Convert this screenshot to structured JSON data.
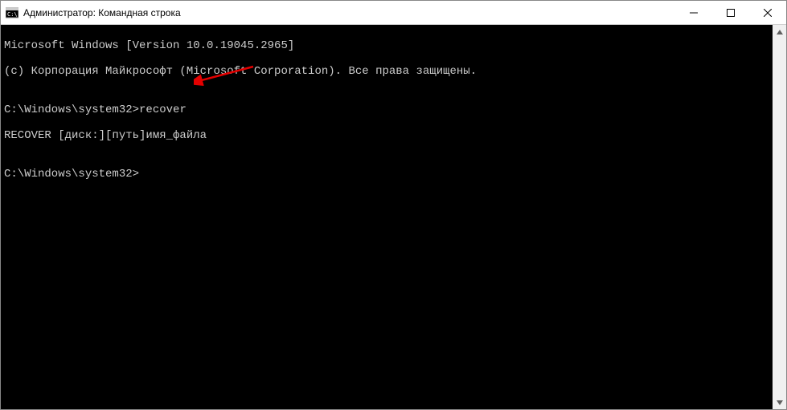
{
  "window": {
    "title": "Администратор: Командная строка"
  },
  "terminal": {
    "line1": "Microsoft Windows [Version 10.0.19045.2965]",
    "line2": "(c) Корпорация Майкрософт (Microsoft Corporation). Все права защищены.",
    "blank1": "",
    "prompt1": "C:\\Windows\\system32>",
    "command1": "recover",
    "output1": "RECOVER [диск:][путь]имя_файла",
    "blank2": "",
    "prompt2": "C:\\Windows\\system32>"
  },
  "icons": {
    "cmd": "cmd-icon",
    "minimize": "minimize-icon",
    "maximize": "maximize-icon",
    "close": "close-icon",
    "scrollUp": "scroll-up-icon",
    "scrollDown": "scroll-down-icon"
  }
}
